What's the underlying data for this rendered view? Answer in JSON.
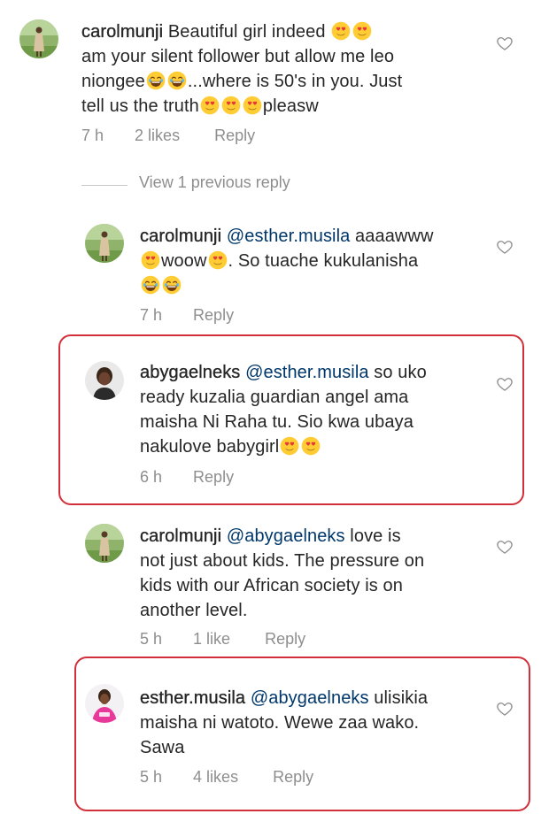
{
  "comments": [
    {
      "username": "carolmunji",
      "lines": [
        {
          "text": " Beautiful girl indeed ",
          "emojis_after": [
            "heart-eyes-emoji",
            "heart-eyes-emoji"
          ]
        },
        {
          "text": "am your silent follower but allow me leo"
        },
        {
          "text": "niongee",
          "emojis_after": [
            "laughing-emoji",
            "laughing-emoji"
          ],
          "tail": "...where is 50's in you. Just"
        },
        {
          "text": "tell us the truth",
          "emojis_after": [
            "heart-eyes-emoji",
            "heart-eyes-emoji",
            "heart-eyes-emoji"
          ],
          "tail": "pleasw"
        }
      ],
      "time": "7 h",
      "likes": "2 likes",
      "reply": "Reply"
    },
    {
      "view_previous": "View 1 previous reply"
    },
    {
      "username": "carolmunji",
      "mention": "@esther.musila",
      "line1_tail": " aaaawww",
      "line2_tail": "woow",
      "line2_rest": ". So tuache kukulanisha",
      "time": "7 h",
      "reply": "Reply"
    },
    {
      "username": "abygaelneks",
      "mention": "@esther.musila",
      "line1_tail": " so uko",
      "line2": "ready kuzalia guardian angel ama",
      "line3": "maisha Ni Raha tu. Sio kwa ubaya",
      "line4": "nakulove babygirl",
      "time": "6 h",
      "reply": "Reply"
    },
    {
      "username": "carolmunji",
      "mention": "@abygaelneks",
      "line1_tail": " love is",
      "line2": "not just about kids. The pressure on",
      "line3": "kids with our African society is on",
      "line4": "another level.",
      "time": "5 h",
      "likes": "1 like",
      "reply": "Reply"
    },
    {
      "username": "esther.musila",
      "mention": "@abygaelneks",
      "line1_tail": " ulisikia",
      "line2": "maisha ni watoto. Wewe zaa wako.",
      "line3": "Sawa",
      "time": "5 h",
      "likes": "4 likes",
      "reply": "Reply"
    }
  ],
  "colors": {
    "text": "#262626",
    "mention": "#00376b",
    "meta": "#8e8e8e",
    "highlight": "#d32f3a"
  },
  "icons": [
    "heart-outline-icon",
    "heart-eyes-emoji",
    "laughing-emoji",
    "avatar"
  ]
}
